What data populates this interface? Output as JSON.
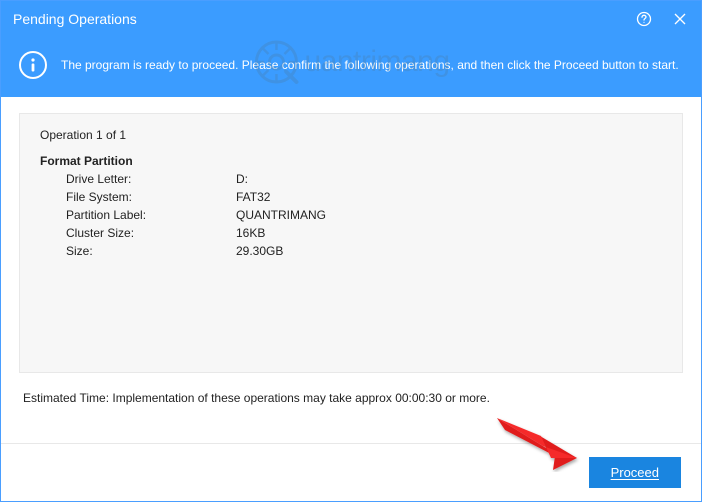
{
  "titlebar": {
    "title": "Pending Operations"
  },
  "banner": {
    "message": "The program is ready to proceed. Please confirm the following operations, and then click the Proceed button to start."
  },
  "operations": {
    "counter": "Operation 1 of 1",
    "title": "Format Partition",
    "rows": [
      {
        "label": "Drive Letter:",
        "value": "D:"
      },
      {
        "label": "File System:",
        "value": "FAT32"
      },
      {
        "label": "Partition Label:",
        "value": "QUANTRIMANG"
      },
      {
        "label": "Cluster Size:",
        "value": "16KB"
      },
      {
        "label": "Size:",
        "value": "29.30GB"
      }
    ]
  },
  "estimated": "Estimated Time: Implementation of these operations may take approx 00:00:30 or more.",
  "footer": {
    "proceed": "Proceed"
  },
  "watermark": {
    "text": "uantrimang"
  }
}
